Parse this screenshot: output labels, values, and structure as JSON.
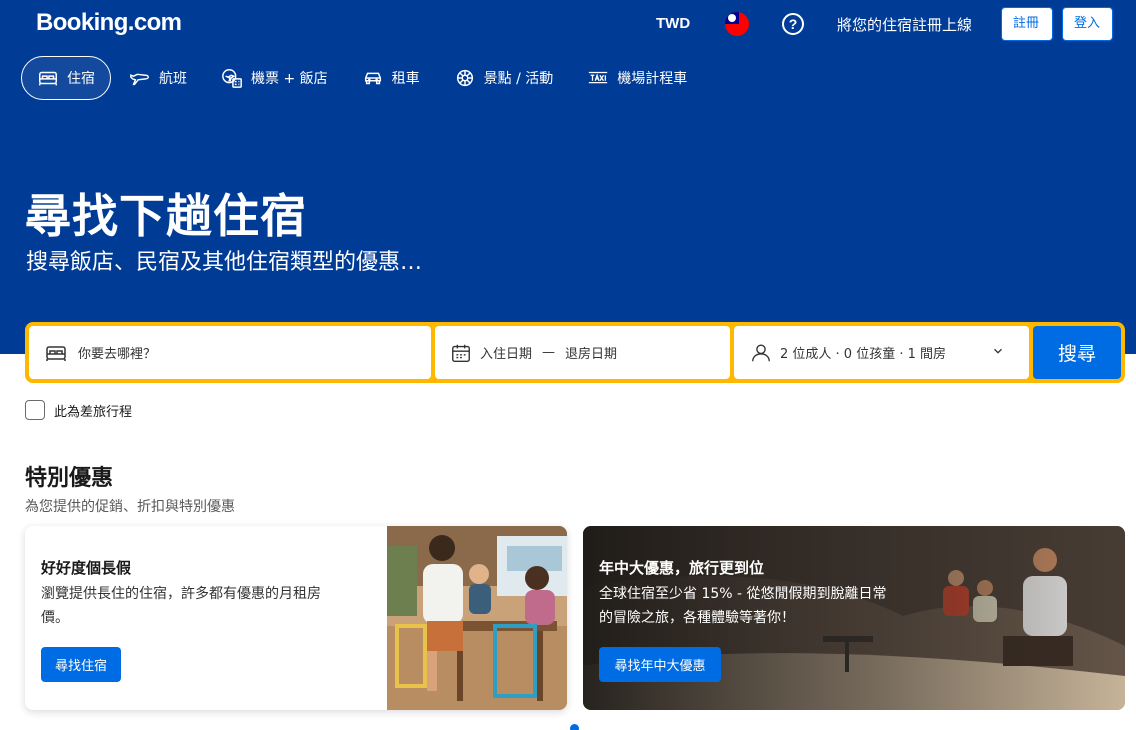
{
  "header": {
    "logo": "Booking.com",
    "currency": "TWD",
    "flag_icon": "taiwan-flag-icon",
    "help_icon": "question-circle-icon",
    "help_glyph": "?",
    "list_property": "將您的住宿註冊上線",
    "register": "註冊",
    "signin": "登入"
  },
  "nav": {
    "items": [
      {
        "label": "住宿",
        "icon": "bed-icon",
        "active": true
      },
      {
        "label": "航班",
        "icon": "plane-icon",
        "active": false
      },
      {
        "label": "機票 + 飯店",
        "icon": "flight-hotel-icon",
        "active": false
      },
      {
        "label": "租車",
        "icon": "car-icon",
        "active": false
      },
      {
        "label": "景點 / 活動",
        "icon": "attraction-icon",
        "active": false
      },
      {
        "label": "機場計程車",
        "icon": "taxi-icon",
        "active": false
      }
    ]
  },
  "hero": {
    "title": "尋找下趟住宿",
    "subtitle": "搜尋飯店、民宿及其他住宿類型的優惠…"
  },
  "search": {
    "destination_placeholder": "你要去哪裡？",
    "checkin": "入住日期",
    "dash": "—",
    "checkout": "退房日期",
    "guests": "2 位成人 · 0 位孩童 · 1 間房",
    "button": "搜尋",
    "business_trip": "此為差旅行程"
  },
  "offers": {
    "title": "特別優惠",
    "subtitle": "為您提供的促銷、折扣與特別優惠",
    "card1": {
      "title": "好好度個長假",
      "body": "瀏覽提供長住的住宿，許多都有優惠的月租房價。",
      "cta": "尋找住宿"
    },
    "card2": {
      "title": "年中大優惠，旅行更到位",
      "body": "全球住宿至少省 15% - 從悠閒假期到脫離日常的冒險之旅，各種體驗等著你！",
      "cta": "尋找年中大優惠"
    }
  },
  "colors": {
    "brand_blue": "#003b95",
    "action_blue": "#006ce4",
    "search_yellow": "#ffb700"
  }
}
